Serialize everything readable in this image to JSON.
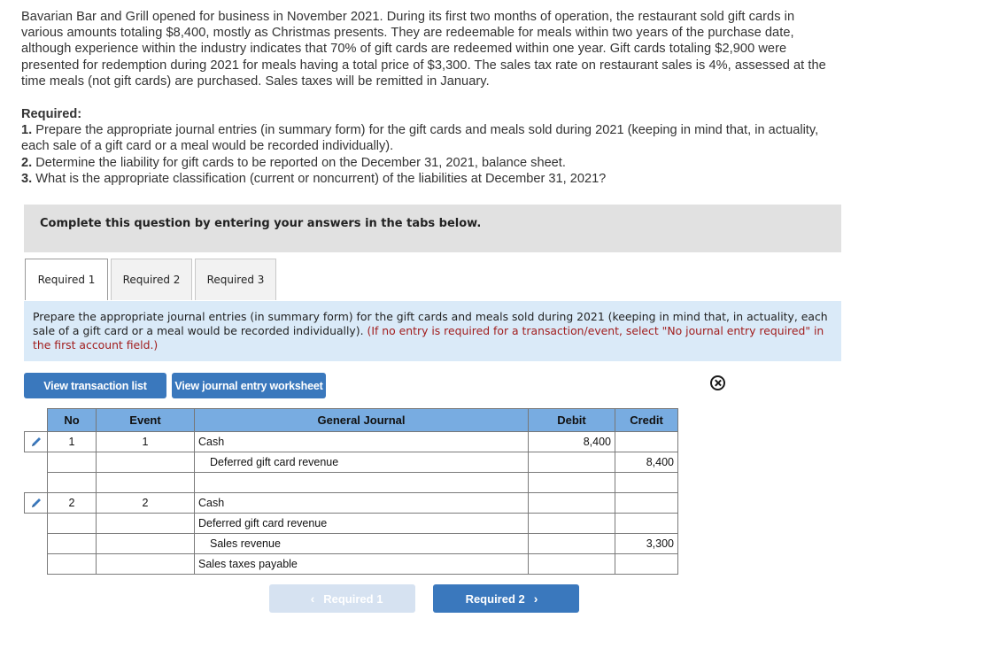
{
  "problem": {
    "text": "Bavarian Bar and Grill opened for business in November 2021. During its first two months of operation, the restaurant sold gift cards in various amounts totaling $8,400, mostly as Christmas presents. They are redeemable for meals within two years of the purchase date, although experience within the industry indicates that 70% of gift cards are redeemed within one year. Gift cards totaling $2,900 were presented for redemption during 2021 for meals having a total price of $3,300. The sales tax rate on restaurant sales is 4%, assessed at the time meals (not gift cards) are purchased. Sales taxes will be remitted in January."
  },
  "required": {
    "heading": "Required:",
    "items": [
      {
        "num": "1.",
        "text": " Prepare the appropriate journal entries (in summary form) for the gift cards and meals sold during 2021 (keeping in mind that, in actuality, each sale of a gift card or a meal would be recorded individually)."
      },
      {
        "num": "2.",
        "text": " Determine the liability for gift cards to be reported on the December 31, 2021, balance sheet."
      },
      {
        "num": "3.",
        "text": " What is the appropriate classification (current or noncurrent) of the liabilities at December 31, 2021?"
      }
    ]
  },
  "instruction": "Complete this question by entering your answers in the tabs below.",
  "tabs": [
    {
      "label": "Required 1",
      "active": true
    },
    {
      "label": "Required 2",
      "active": false
    },
    {
      "label": "Required 3",
      "active": false
    }
  ],
  "info_panel": {
    "text": "Prepare the appropriate journal entries (in summary form) for the gift cards and meals sold during 2021 (keeping in mind that, in actuality, each sale of a gift card or a meal would be recorded individually). ",
    "note": "(If no entry is required for a transaction/event, select \"No journal entry required\" in the first account field.)"
  },
  "buttons": {
    "view_transaction_list": "View transaction list",
    "view_journal_worksheet": "View journal entry worksheet"
  },
  "journal": {
    "headers": {
      "no": "No",
      "event": "Event",
      "account": "General Journal",
      "debit": "Debit",
      "credit": "Credit"
    },
    "rows": [
      {
        "no": "1",
        "event": "1",
        "account": "Cash",
        "indent": false,
        "debit": "8,400",
        "credit": ""
      },
      {
        "no": "",
        "event": "",
        "account": "Deferred gift card revenue",
        "indent": true,
        "debit": "",
        "credit": "8,400"
      },
      {
        "no": "",
        "event": "",
        "account": "",
        "indent": false,
        "debit": "",
        "credit": ""
      },
      {
        "no": "2",
        "event": "2",
        "account": "Cash",
        "indent": false,
        "debit": "",
        "credit": ""
      },
      {
        "no": "",
        "event": "",
        "account": "Deferred gift card revenue",
        "indent": false,
        "debit": "",
        "credit": ""
      },
      {
        "no": "",
        "event": "",
        "account": "Sales revenue",
        "indent": true,
        "debit": "",
        "credit": "3,300"
      },
      {
        "no": "",
        "event": "",
        "account": "Sales taxes payable",
        "indent": false,
        "debit": "",
        "credit": ""
      }
    ]
  },
  "nav": {
    "prev_label": "Required 1",
    "next_label": "Required 2"
  },
  "colors": {
    "header_blue": "#78ace1",
    "button_blue": "#3a78bd",
    "info_bg": "#daeaf8",
    "note_red": "#a11d1d"
  }
}
